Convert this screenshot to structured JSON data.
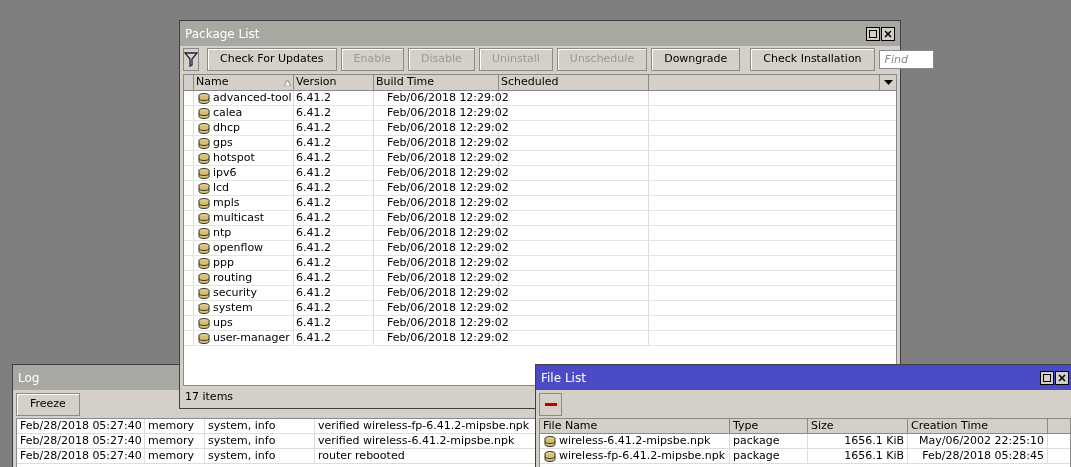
{
  "package_list": {
    "title": "Package List",
    "toolbar": [
      {
        "label": "Check For Updates",
        "disabled": false
      },
      {
        "label": "Enable",
        "disabled": true
      },
      {
        "label": "Disable",
        "disabled": true
      },
      {
        "label": "Uninstall",
        "disabled": true
      },
      {
        "label": "Unschedule",
        "disabled": true
      },
      {
        "label": "Downgrade",
        "disabled": false
      },
      {
        "label": "Check Installation",
        "disabled": false
      }
    ],
    "find": {
      "placeholder": "Find"
    },
    "columns": [
      "Name",
      "Version",
      "Build Time",
      "Scheduled"
    ],
    "rows": [
      {
        "name": "advanced-tool",
        "version": "6.41.2",
        "build_time": "Feb/06/2018 12:29:02"
      },
      {
        "name": "calea",
        "version": "6.41.2",
        "build_time": "Feb/06/2018 12:29:02"
      },
      {
        "name": "dhcp",
        "version": "6.41.2",
        "build_time": "Feb/06/2018 12:29:02"
      },
      {
        "name": "gps",
        "version": "6.41.2",
        "build_time": "Feb/06/2018 12:29:02"
      },
      {
        "name": "hotspot",
        "version": "6.41.2",
        "build_time": "Feb/06/2018 12:29:02"
      },
      {
        "name": "ipv6",
        "version": "6.41.2",
        "build_time": "Feb/06/2018 12:29:02"
      },
      {
        "name": "lcd",
        "version": "6.41.2",
        "build_time": "Feb/06/2018 12:29:02"
      },
      {
        "name": "mpls",
        "version": "6.41.2",
        "build_time": "Feb/06/2018 12:29:02"
      },
      {
        "name": "multicast",
        "version": "6.41.2",
        "build_time": "Feb/06/2018 12:29:02"
      },
      {
        "name": "ntp",
        "version": "6.41.2",
        "build_time": "Feb/06/2018 12:29:02"
      },
      {
        "name": "openflow",
        "version": "6.41.2",
        "build_time": "Feb/06/2018 12:29:02"
      },
      {
        "name": "ppp",
        "version": "6.41.2",
        "build_time": "Feb/06/2018 12:29:02"
      },
      {
        "name": "routing",
        "version": "6.41.2",
        "build_time": "Feb/06/2018 12:29:02"
      },
      {
        "name": "security",
        "version": "6.41.2",
        "build_time": "Feb/06/2018 12:29:02"
      },
      {
        "name": "system",
        "version": "6.41.2",
        "build_time": "Feb/06/2018 12:29:02"
      },
      {
        "name": "ups",
        "version": "6.41.2",
        "build_time": "Feb/06/2018 12:29:02"
      },
      {
        "name": "user-manager",
        "version": "6.41.2",
        "build_time": "Feb/06/2018 12:29:02"
      }
    ],
    "status_bar": "17 items"
  },
  "log": {
    "title": "Log",
    "button": "Freeze",
    "rows": [
      {
        "time": "Feb/28/2018 05:27:40",
        "buffer": "memory",
        "topics": "system, info",
        "message": "verified wireless-fp-6.41.2-mipsbe.npk"
      },
      {
        "time": "Feb/28/2018 05:27:40",
        "buffer": "memory",
        "topics": "system, info",
        "message": "verified wireless-6.41.2-mipsbe.npk"
      },
      {
        "time": "Feb/28/2018 05:27:40",
        "buffer": "memory",
        "topics": "system, info",
        "message": "router rebooted"
      }
    ]
  },
  "file_list": {
    "title": "File List",
    "columns": [
      "File Name",
      "Type",
      "Size",
      "Creation Time"
    ],
    "rows": [
      {
        "name": "wireless-6.41.2-mipsbe.npk",
        "type": "package",
        "size": "1656.1 KiB",
        "created": "May/06/2002 22:25:10",
        "selected": false
      },
      {
        "name": "wireless-fp-6.41.2-mipsbe.npk",
        "type": "package",
        "size": "1656.1 KiB",
        "created": "Feb/28/2018 05:28:45",
        "selected": false
      }
    ]
  }
}
